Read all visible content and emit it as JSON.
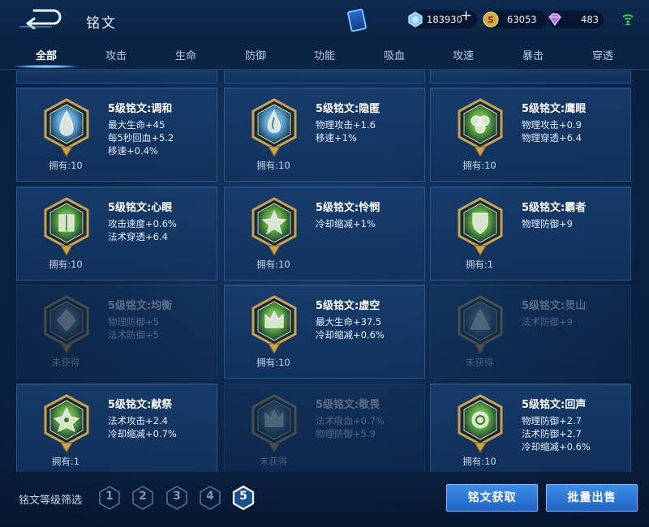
{
  "header": {
    "title": "铭文",
    "currencies": {
      "crystal": "183930",
      "gold": "63053",
      "diamond": "483"
    },
    "plus_label": "+"
  },
  "tabs": [
    {
      "label": "全部",
      "active": true
    },
    {
      "label": "攻击"
    },
    {
      "label": "生命"
    },
    {
      "label": "防御"
    },
    {
      "label": "功能"
    },
    {
      "label": "吸血"
    },
    {
      "label": "攻速"
    },
    {
      "label": "暴击"
    },
    {
      "label": "穿透"
    }
  ],
  "runes": [
    {
      "name": "5级铭文:调和",
      "stats": [
        "最大生命+45",
        "每5秒回血+5.2",
        "移速+0.4%"
      ],
      "owned": "拥有:10",
      "locked": false,
      "color": "#5fa8d8",
      "gem": "drop"
    },
    {
      "name": "5级铭文:隐匿",
      "stats": [
        "物理攻击+1.6",
        "移速+1%"
      ],
      "owned": "拥有:10",
      "locked": false,
      "color": "#5fa8d8",
      "gem": "flame"
    },
    {
      "name": "5级铭文:鹰眼",
      "stats": [
        "物理攻击+0.9",
        "物理穿透+6.4"
      ],
      "owned": "拥有:10",
      "locked": false,
      "color": "#5cab3a",
      "gem": "clover"
    },
    {
      "name": "5级铭文:心眼",
      "stats": [
        "攻击速度+0.6%",
        "法术穿透+6.4"
      ],
      "owned": "拥有:10",
      "locked": false,
      "color": "#5cab3a",
      "gem": "box"
    },
    {
      "name": "5级铭文:怜悯",
      "stats": [
        "冷却缩减+1%"
      ],
      "owned": "拥有:10",
      "locked": false,
      "color": "#5cab3a",
      "gem": "star"
    },
    {
      "name": "5级铭文:霸者",
      "stats": [
        "物理防御+9"
      ],
      "owned": "拥有:1",
      "locked": false,
      "color": "#5cab3a",
      "gem": "shield"
    },
    {
      "name": "5级铭文:均衡",
      "stats": [
        "物理防御+5",
        "法术防御+5"
      ],
      "owned": "未获得",
      "locked": true,
      "color": "#5e7a88",
      "gem": "diamond"
    },
    {
      "name": "5级铭文:虚空",
      "stats": [
        "最大生命+37.5",
        "冷却缩减+0.6%"
      ],
      "owned": "拥有:10",
      "locked": false,
      "color": "#5cab3a",
      "gem": "crown"
    },
    {
      "name": "5级铭文:灵山",
      "stats": [
        "法术防御+9"
      ],
      "owned": "未获得",
      "locked": true,
      "color": "#5e7a88",
      "gem": "triangle"
    },
    {
      "name": "5级铭文:献祭",
      "stats": [
        "法术攻击+2.4",
        "冷却缩减+0.7%"
      ],
      "owned": "拥有:1",
      "locked": false,
      "color": "#5cab3a",
      "gem": "flower"
    },
    {
      "name": "5级铭文:敬畏",
      "stats": [
        "法术吸血+0.7%",
        "物理防御+5.9"
      ],
      "owned": "未获得",
      "locked": true,
      "color": "#5e7a88",
      "gem": "crown"
    },
    {
      "name": "5级铭文:回声",
      "stats": [
        "物理防御+2.7",
        "法术防御+2.7",
        "冷却缩减+0.6%"
      ],
      "owned": "拥有:10",
      "locked": false,
      "color": "#5cab3a",
      "gem": "ring"
    }
  ],
  "footer": {
    "filter_label": "铭文等级筛选",
    "levels": [
      "1",
      "2",
      "3",
      "4",
      "5"
    ],
    "active_level": "5",
    "get_runes_label": "铭文获取",
    "bulk_sell_label": "批量出售"
  }
}
